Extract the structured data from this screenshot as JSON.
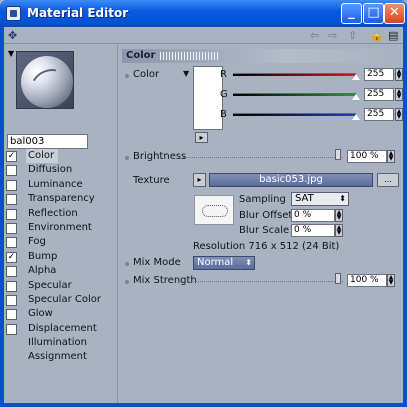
{
  "window": {
    "title": "Material Editor",
    "min_glyph": "_",
    "max_glyph": "□",
    "close_glyph": "✕"
  },
  "toolbar": {
    "pick_glyph": "✥",
    "back_glyph": "⇦",
    "forward_glyph": "⇨",
    "up_glyph": "⇧",
    "lock_glyph": "🔒",
    "menu_glyph": "▤"
  },
  "material": {
    "name": "bal003",
    "preview_arrow": "▼"
  },
  "channels": [
    {
      "label": "Color",
      "checked": true,
      "selected": true
    },
    {
      "label": "Diffusion",
      "checked": false
    },
    {
      "label": "Luminance",
      "checked": false
    },
    {
      "label": "Transparency",
      "checked": false
    },
    {
      "label": "Reflection",
      "checked": false
    },
    {
      "label": "Environment",
      "checked": false
    },
    {
      "label": "Fog",
      "checked": false
    },
    {
      "label": "Bump",
      "checked": true
    },
    {
      "label": "Alpha",
      "checked": false
    },
    {
      "label": "Specular",
      "checked": false
    },
    {
      "label": "Specular Color",
      "checked": false
    },
    {
      "label": "Glow",
      "checked": false
    },
    {
      "label": "Displacement",
      "checked": false
    },
    {
      "label": "Illumination",
      "no_checkbox": true
    },
    {
      "label": "Assignment",
      "no_checkbox": true
    }
  ],
  "color_section": {
    "title": "Color",
    "color_label": "Color",
    "color_dropdown": "▼",
    "swatch_color": "#ffffff",
    "swatch_button": "▸",
    "r_label": "R",
    "g_label": "G",
    "b_label": "B",
    "r_value": "255",
    "g_value": "255",
    "b_value": "255",
    "r_level": 1.0,
    "g_level": 1.0,
    "b_level": 1.0,
    "brightness_label": "Brightness",
    "brightness_value": "100 %",
    "brightness_level": 1.0,
    "texture_label": "Texture",
    "texture_arrow": "▸",
    "texture_file": "basic053.jpg",
    "texture_more": "...",
    "sampling_label": "Sampling",
    "sampling_value": "SAT",
    "blur_offset_label": "Blur Offset",
    "blur_offset_value": "0 %",
    "blur_scale_label": "Blur Scale",
    "blur_scale_value": "0 %",
    "resolution": "Resolution 716 x 512 (24 Bit)",
    "mix_mode_label": "Mix Mode",
    "mix_mode_value": "Normal",
    "mix_strength_label": "Mix Strength",
    "mix_strength_value": "100 %",
    "mix_strength_level": 1.0
  },
  "colors": {
    "accent": "#0a5ae0",
    "panel": "#a9b2c0",
    "r_slider": "#d02020",
    "g_slider": "#20a020",
    "b_slider": "#2040c0"
  }
}
